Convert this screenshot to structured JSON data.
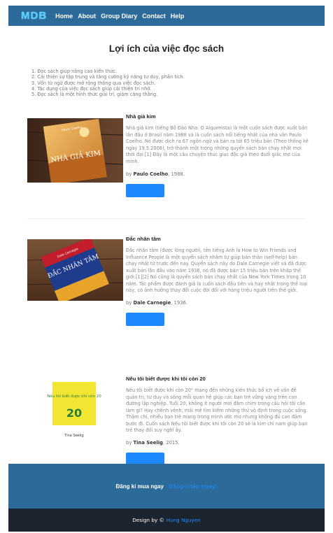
{
  "nav": {
    "logo": "MDB",
    "links": [
      "Home",
      "About",
      "Group Diary",
      "Contact",
      "Help"
    ]
  },
  "page": {
    "title": "Lợi ích của việc đọc sách",
    "benefits": [
      "1. Đọc sách giúp nâng cao kiến thức.",
      "2. Cải thiện sự tập trung và tăng cường kỹ năng tư duy, phân tích.",
      "3. Vốn từ ngữ được mở rộng thông qua việc đọc sách.",
      "4. Tác dụng của việc đọc sách giúp cải thiện trí nhớ.",
      "5. Đọc sách là một hình thức giải trí, giảm căng thẳng."
    ]
  },
  "books": [
    {
      "title": "Nhà giả kim",
      "description": "Nhà giả kim (tiếng Bồ Đào Nha: O Alquimista) là một cuốn sách được xuất bản lần đầu ở Brasil năm 1988 và là cuốn sách nổi tiếng nhất của nhà văn Paulo Coelho. Nó được dịch ra 67 ngôn ngữ và bán ra tới 65 triệu bản (Theo thống kê ngày 19.5.2008), trở thành một trong những quyển sách bán chạy nhất mọi thời đại.[1] Đây là một câu chuyện thúc giục độc giả theo đuổi giấc mơ của mình.",
      "author_prefix": "by",
      "author": "Paulo Coelho",
      "year": ", 1988.",
      "cover_title": "NHÀ GIẢ KIM",
      "cover_author": "Paulo Coelho"
    },
    {
      "title": "Đắc nhân tâm",
      "description": "Đắc nhân tâm (được lòng người), tên tiếng Anh là How to Win Friends and Influence People là một quyển sách nhằm tự giúp bản thân (self-help) bán chạy nhất từ trước đến nay. Quyển sách này do Dale Carnegie viết và đã được xuất bản lần đầu vào năm 1936, nó đã được bán 15 triệu bản trên khắp thế giới.[1][2] Nó cũng là quyển sách bán chạy nhất của New York Times trong 10 năm. Tác phẩm được đánh giá là cuốn sách đầu tiên và hay nhất trong thể loại này, có ảnh hưởng thay đổi cuộc đời đối với hàng triệu người trên thế giới.",
      "author_prefix": "by",
      "author": "Dale Carnegie",
      "year": ", 1936.",
      "cover_title": "ĐẮC NHÂN TÂM",
      "cover_author": "Dale Carnegie"
    },
    {
      "title": "Nếu tôi biết được khi tôi còn 20",
      "description": "Nếu tôi biết được khi còn 20\" mang đến những kiến thức bổ ích về vấn đề quản trị, tư duy và sống mỗi quan hệ giúp các bạn trẻ vững vàng trên con đường lập nghiệp. Tuổi 20, không ít người mơi đắm chìm trong câu hỏi tôi cần làm gì? Hay chênh vênh, mải mê tìm kiếm những thứ vô định trong cuộc sống. Thậm chí, nhiều bạn trẻ mang trong mình ước mơ nhưng không đủ can đảm bước đi. Cuốn sách Nếu tôi biết được khi tôi còn 20 sẽ là kim chỉ nam giúp bạn trẻ thay đổi suy nghĩ ấy.",
      "author_prefix": "by",
      "author": "Tina Seelig",
      "year": ", 2015.",
      "cover_title": "Nếu tôi biết được khi còn 20",
      "cover_author": "Tina Seelig"
    }
  ],
  "footer": {
    "cta_text": "Đăng kí mua ngay",
    "cta_link": "Đăng nhập ngay!",
    "design_by": "Design by ©",
    "design_author": "Hung Nguyen"
  },
  "colors": {
    "navbar": "#2c6a9a",
    "logo": "#4fd0ff",
    "button": "#1e88ff",
    "footer_bottom": "#1c2430",
    "link": "#1f8bff"
  }
}
